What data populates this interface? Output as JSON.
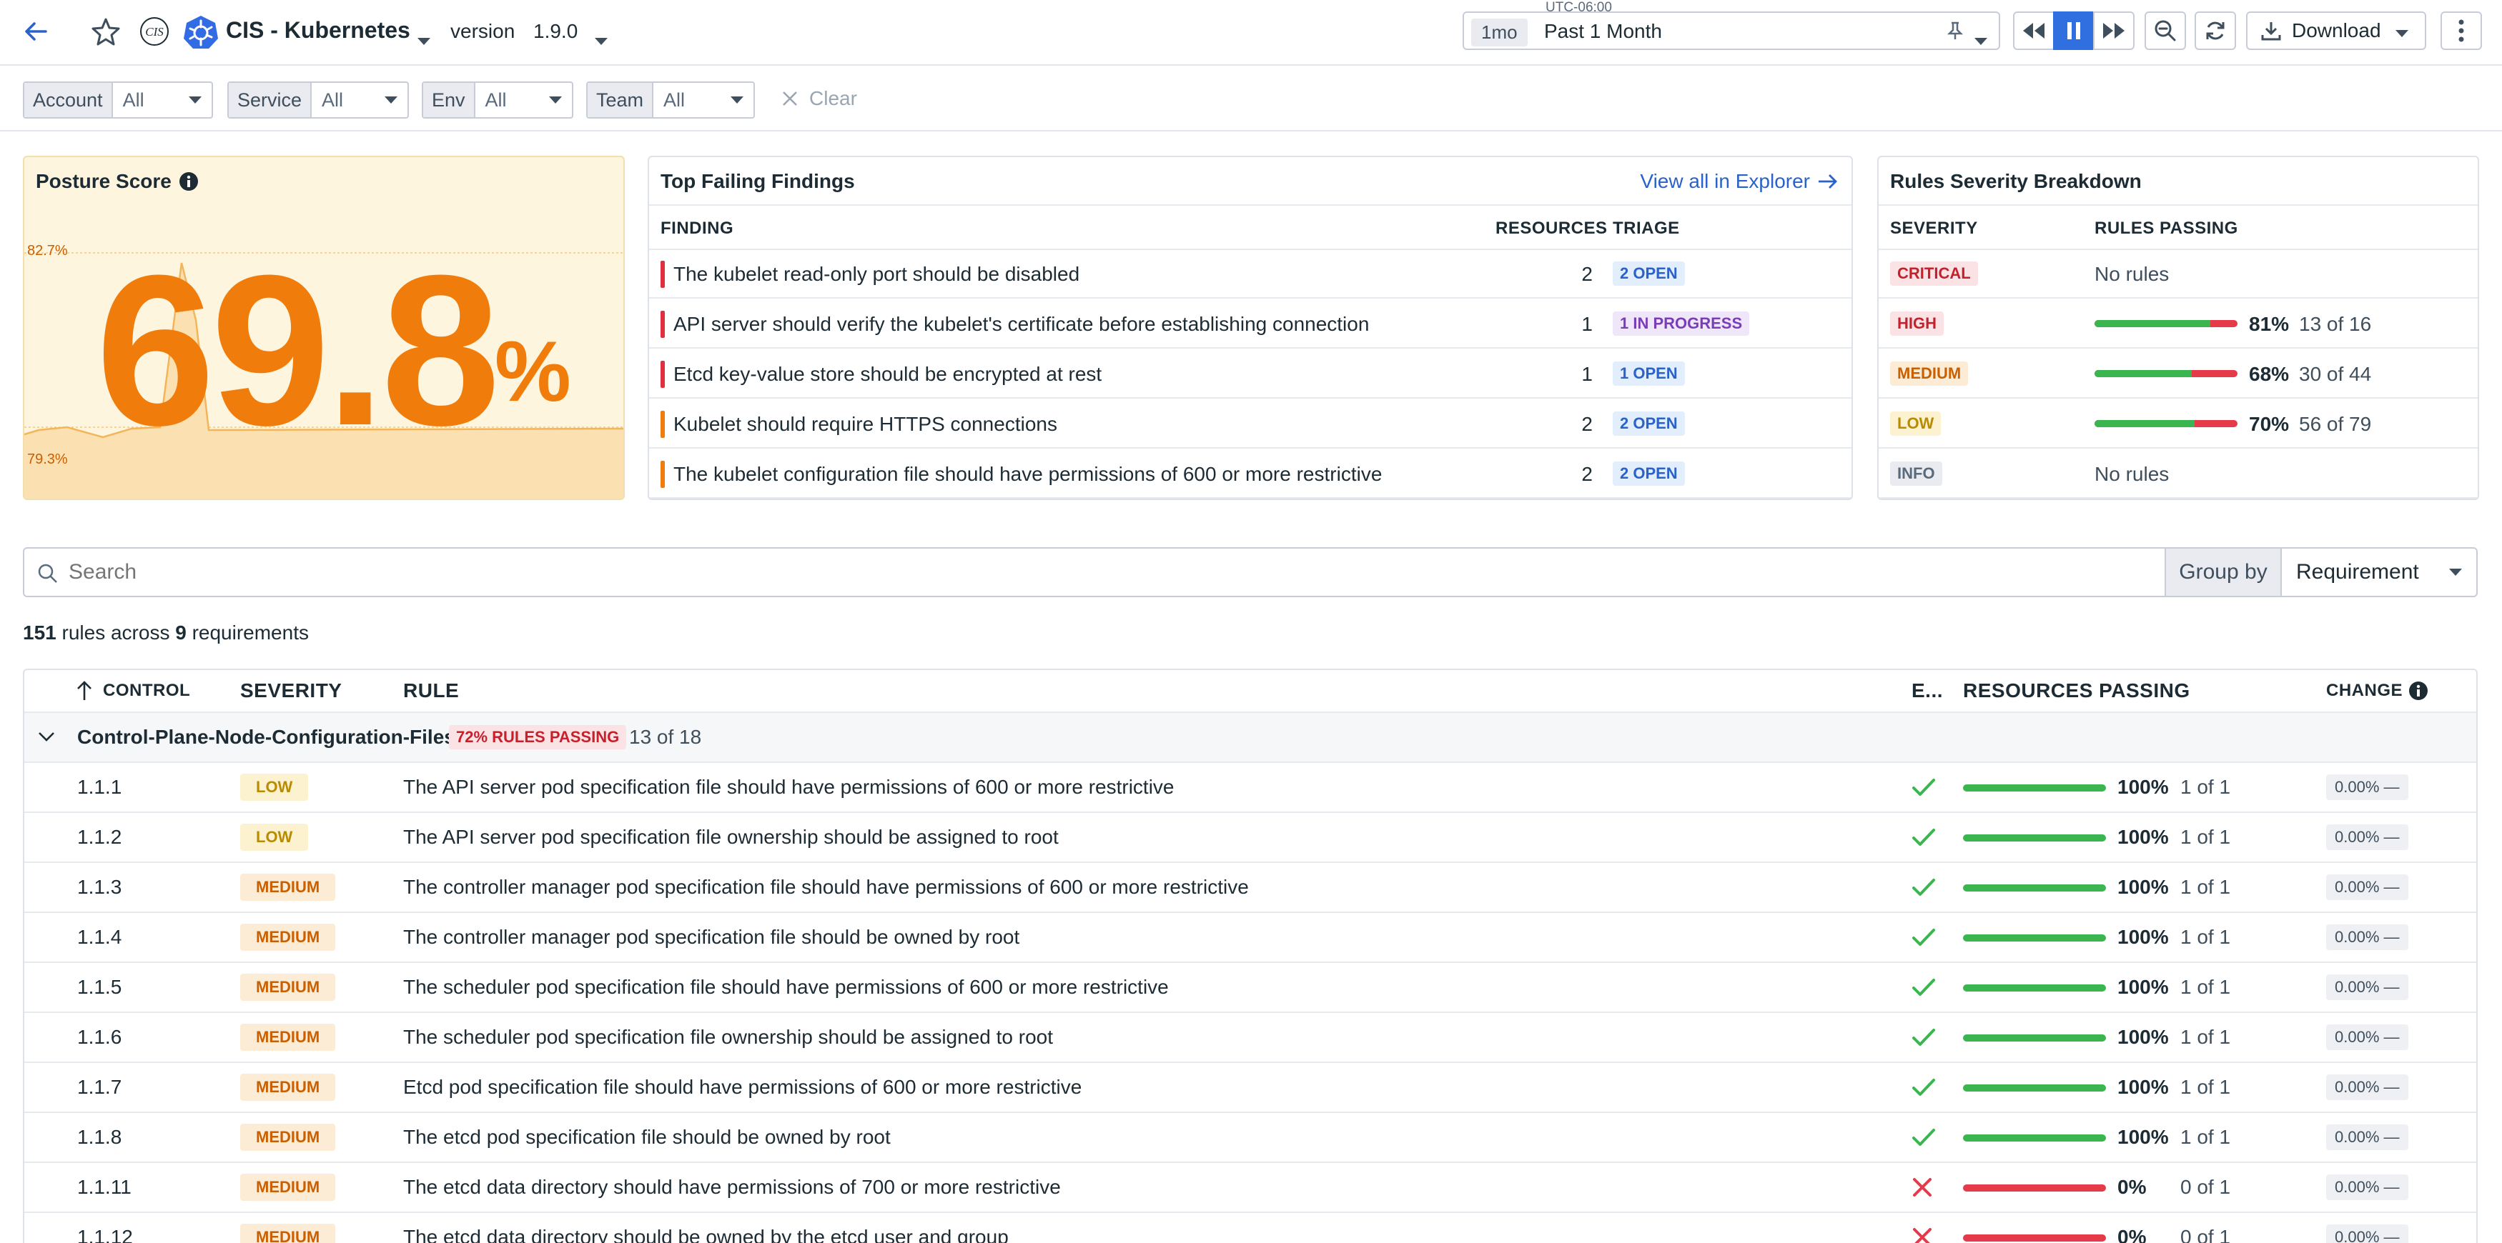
{
  "header": {
    "title": "CIS - Kubernetes",
    "version_label": "version",
    "version_value": "1.9.0",
    "timezone": "UTC-06:00",
    "time_short": "1mo",
    "time_range": "Past 1 Month",
    "download_label": "Download"
  },
  "filters": [
    {
      "label": "Account",
      "value": "All"
    },
    {
      "label": "Service",
      "value": "All"
    },
    {
      "label": "Env",
      "value": "All"
    },
    {
      "label": "Team",
      "value": "All"
    }
  ],
  "clear_label": "Clear",
  "posture": {
    "title": "Posture Score",
    "score": "69.8",
    "unit": "%",
    "y_high_label": "82.7%",
    "y_low_label": "79.3%"
  },
  "top_failing": {
    "title": "Top Failing Findings",
    "view_all": "View all in Explorer",
    "headers": {
      "finding": "FINDING",
      "resources": "RESOURCES",
      "triage": "TRIAGE"
    },
    "rows": [
      {
        "finding": "The kubelet read-only port should be disabled",
        "resources": "2",
        "triage": "2 OPEN",
        "color": "#e0303f",
        "kind": "open"
      },
      {
        "finding": "API server should verify the kubelet's certificate before establishing connection",
        "resources": "1",
        "triage": "1 IN PROGRESS",
        "color": "#e0303f",
        "kind": "progress"
      },
      {
        "finding": "Etcd key-value store should be encrypted at rest",
        "resources": "1",
        "triage": "1 OPEN",
        "color": "#e0303f",
        "kind": "open"
      },
      {
        "finding": "Kubelet should require HTTPS connections",
        "resources": "2",
        "triage": "2 OPEN",
        "color": "#f07d0b",
        "kind": "open"
      },
      {
        "finding": "The kubelet configuration file should have permissions of 600 or more restrictive",
        "resources": "2",
        "triage": "2 OPEN",
        "color": "#f07d0b",
        "kind": "open"
      }
    ]
  },
  "severity_breakdown": {
    "title": "Rules Severity Breakdown",
    "headers": {
      "severity": "SEVERITY",
      "passing": "RULES PASSING"
    },
    "rows": [
      {
        "severity": "CRITICAL",
        "cls": "sev-critical",
        "text": "No rules"
      },
      {
        "severity": "HIGH",
        "cls": "sev-high",
        "pct": "81%",
        "count": "13 of 16",
        "fraction": 0.81
      },
      {
        "severity": "MEDIUM",
        "cls": "sev-medium",
        "pct": "68%",
        "count": "30 of 44",
        "fraction": 0.68
      },
      {
        "severity": "LOW",
        "cls": "sev-low",
        "pct": "70%",
        "count": "56 of 79",
        "fraction": 0.7
      },
      {
        "severity": "INFO",
        "cls": "sev-info",
        "text": "No rules"
      }
    ]
  },
  "search": {
    "placeholder": "Search",
    "group_by_label": "Group by",
    "group_by_value": "Requirement"
  },
  "summary": {
    "rules": "151",
    "mid": "rules across",
    "requirements": "9",
    "tail": "requirements"
  },
  "table": {
    "headers": {
      "control": "CONTROL",
      "severity": "SEVERITY",
      "rule": "RULE",
      "e": "E...",
      "resources": "RESOURCES PASSING",
      "change": "CHANGE"
    },
    "group": {
      "name": "Control-Plane-Node-Configuration-Files",
      "badge": "72% RULES PASSING",
      "count": "13 of 18"
    },
    "rows": [
      {
        "control": "1.1.1",
        "severity": "LOW",
        "rule": "The API server pod specification file should have permissions of 600 or more restrictive",
        "pass": true,
        "pct": "100%",
        "count": "1 of 1",
        "change": "0.00% —",
        "fraction": 1
      },
      {
        "control": "1.1.2",
        "severity": "LOW",
        "rule": "The API server pod specification file ownership should be assigned to root",
        "pass": true,
        "pct": "100%",
        "count": "1 of 1",
        "change": "0.00% —",
        "fraction": 1
      },
      {
        "control": "1.1.3",
        "severity": "MEDIUM",
        "rule": "The controller manager pod specification file should have permissions of 600 or more restrictive",
        "pass": true,
        "pct": "100%",
        "count": "1 of 1",
        "change": "0.00% —",
        "fraction": 1
      },
      {
        "control": "1.1.4",
        "severity": "MEDIUM",
        "rule": "The controller manager pod specification file should be owned by root",
        "pass": true,
        "pct": "100%",
        "count": "1 of 1",
        "change": "0.00% —",
        "fraction": 1
      },
      {
        "control": "1.1.5",
        "severity": "MEDIUM",
        "rule": "The scheduler pod specification file should have permissions of 600 or more restrictive",
        "pass": true,
        "pct": "100%",
        "count": "1 of 1",
        "change": "0.00% —",
        "fraction": 1
      },
      {
        "control": "1.1.6",
        "severity": "MEDIUM",
        "rule": "The scheduler pod specification file ownership should be assigned to root",
        "pass": true,
        "pct": "100%",
        "count": "1 of 1",
        "change": "0.00% —",
        "fraction": 1
      },
      {
        "control": "1.1.7",
        "severity": "MEDIUM",
        "rule": "Etcd pod specification file should have permissions of 600 or more restrictive",
        "pass": true,
        "pct": "100%",
        "count": "1 of 1",
        "change": "0.00% —",
        "fraction": 1
      },
      {
        "control": "1.1.8",
        "severity": "MEDIUM",
        "rule": "The etcd pod specification file should be owned by root",
        "pass": true,
        "pct": "100%",
        "count": "1 of 1",
        "change": "0.00% —",
        "fraction": 1
      },
      {
        "control": "1.1.11",
        "severity": "MEDIUM",
        "rule": "The etcd data directory should have permissions of 700 or more restrictive",
        "pass": false,
        "pct": "0%",
        "count": "0 of 1",
        "change": "0.00% —",
        "fraction": 0
      },
      {
        "control": "1.1.12",
        "severity": "MEDIUM",
        "rule": "The etcd data directory should be owned by the etcd user and group",
        "pass": false,
        "pct": "0%",
        "count": "0 of 1",
        "change": "0.00% —",
        "fraction": 0
      }
    ]
  },
  "colors": {
    "accent": "#f07d0b",
    "link": "#2b62c9",
    "pass": "#3bb550",
    "fail": "#e53a4a",
    "play": "#2f6fe0"
  }
}
